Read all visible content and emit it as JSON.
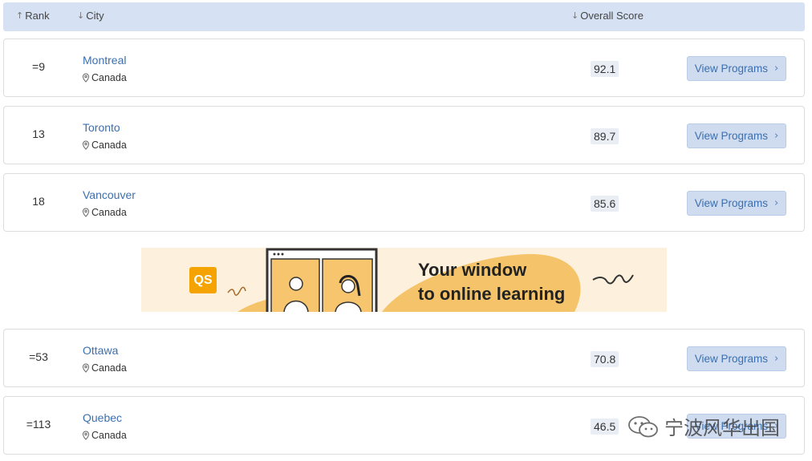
{
  "header": {
    "rank_label": "Rank",
    "rank_sort_icon": "up-arrow",
    "city_label": "City",
    "city_sort_icon": "down-arrow",
    "score_label": "Overall Score",
    "score_sort_icon": "down-arrow"
  },
  "rows": [
    {
      "rank": "=9",
      "city": "Montreal",
      "country": "Canada",
      "score": "92.1",
      "button": "View Programs"
    },
    {
      "rank": "13",
      "city": "Toronto",
      "country": "Canada",
      "score": "89.7",
      "button": "View Programs"
    },
    {
      "rank": "18",
      "city": "Vancouver",
      "country": "Canada",
      "score": "85.6",
      "button": "View Programs"
    },
    {
      "rank": "=53",
      "city": "Ottawa",
      "country": "Canada",
      "score": "70.8",
      "button": "View Programs"
    },
    {
      "rank": "=113",
      "city": "Quebec",
      "country": "Canada",
      "score": "46.5",
      "button": "View Programs"
    }
  ],
  "banner": {
    "logo_text": "QS",
    "line1": "Your window",
    "line2": "to online learning",
    "accent_color": "#f5c46a"
  },
  "watermark": {
    "text": "宁波风华出国",
    "icon": "wechat-icon"
  },
  "colors": {
    "header_bg": "#d6e2f4",
    "link": "#3b6fb0",
    "button_bg": "#cfdcf0"
  }
}
